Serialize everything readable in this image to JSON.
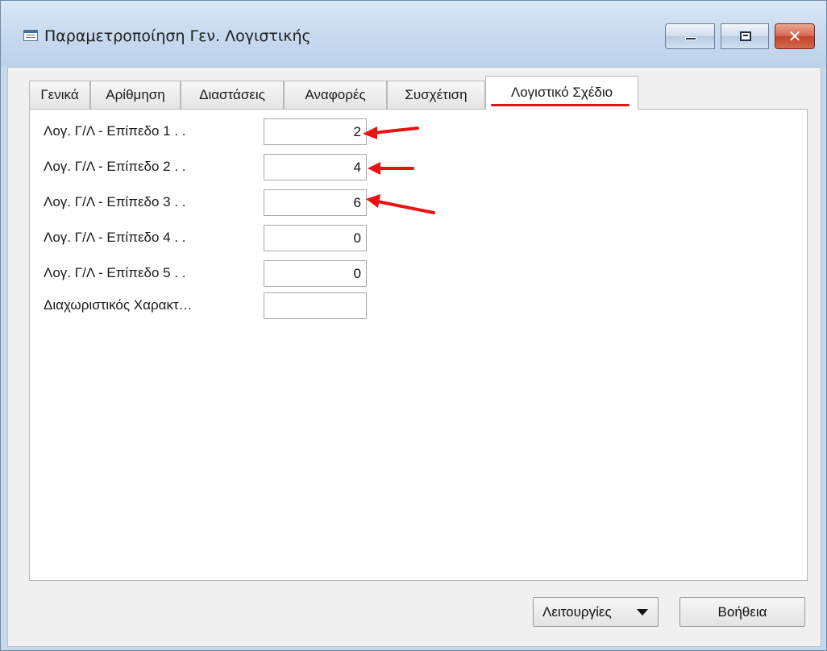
{
  "window": {
    "title": "Παραμετροποίηση Γεν. Λογιστικής",
    "icon": "form-icon",
    "controls": [
      "minimize-icon",
      "maximize-icon",
      "close-icon"
    ],
    "close_glyph": "✕"
  },
  "tabs": [
    {
      "label": "Γενικά",
      "active": false
    },
    {
      "label": "Αρίθμηση",
      "active": false
    },
    {
      "label": "Διαστάσεις",
      "active": false
    },
    {
      "label": "Αναφορές",
      "active": false
    },
    {
      "label": "Συσχέτιση",
      "active": false
    },
    {
      "label": "Λογιστικό Σχέδιο",
      "active": true
    }
  ],
  "fields": [
    {
      "label": "Λογ. Γ/Λ - Επίπεδο 1  . .",
      "value": "2"
    },
    {
      "label": "Λογ. Γ/Λ - Επίπεδο 2  . .",
      "value": "4"
    },
    {
      "label": "Λογ. Γ/Λ - Επίπεδο 3  . .",
      "value": "6"
    },
    {
      "label": "Λογ. Γ/Λ - Επίπεδο 4  . .",
      "value": "0"
    },
    {
      "label": "Λογ. Γ/Λ - Επίπεδο 5  . .",
      "value": "0"
    },
    {
      "label": "Διαχωριστικός Χαρακτ…",
      "value": ""
    }
  ],
  "buttons": {
    "functions": "Λειτουργίες",
    "help": "Βοήθεια"
  },
  "colors": {
    "annotation": "#ea1212",
    "titlebar": "#c9dbef",
    "close": "#c0432b"
  }
}
